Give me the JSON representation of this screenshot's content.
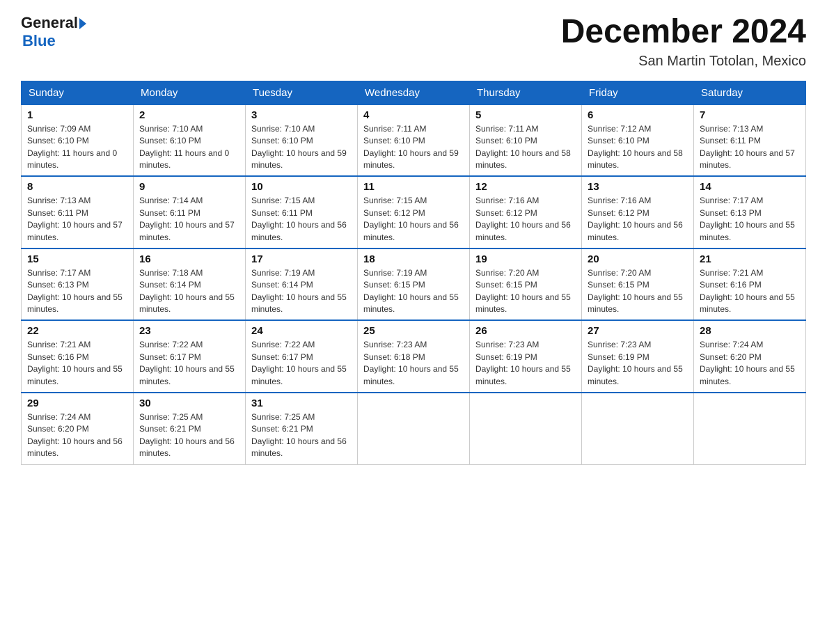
{
  "logo": {
    "general_text": "General",
    "blue_text": "Blue"
  },
  "title": "December 2024",
  "location": "San Martin Totolan, Mexico",
  "days_of_week": [
    "Sunday",
    "Monday",
    "Tuesday",
    "Wednesday",
    "Thursday",
    "Friday",
    "Saturday"
  ],
  "weeks": [
    [
      {
        "day": "1",
        "sunrise": "7:09 AM",
        "sunset": "6:10 PM",
        "daylight": "11 hours and 0 minutes."
      },
      {
        "day": "2",
        "sunrise": "7:10 AM",
        "sunset": "6:10 PM",
        "daylight": "11 hours and 0 minutes."
      },
      {
        "day": "3",
        "sunrise": "7:10 AM",
        "sunset": "6:10 PM",
        "daylight": "10 hours and 59 minutes."
      },
      {
        "day": "4",
        "sunrise": "7:11 AM",
        "sunset": "6:10 PM",
        "daylight": "10 hours and 59 minutes."
      },
      {
        "day": "5",
        "sunrise": "7:11 AM",
        "sunset": "6:10 PM",
        "daylight": "10 hours and 58 minutes."
      },
      {
        "day": "6",
        "sunrise": "7:12 AM",
        "sunset": "6:10 PM",
        "daylight": "10 hours and 58 minutes."
      },
      {
        "day": "7",
        "sunrise": "7:13 AM",
        "sunset": "6:11 PM",
        "daylight": "10 hours and 57 minutes."
      }
    ],
    [
      {
        "day": "8",
        "sunrise": "7:13 AM",
        "sunset": "6:11 PM",
        "daylight": "10 hours and 57 minutes."
      },
      {
        "day": "9",
        "sunrise": "7:14 AM",
        "sunset": "6:11 PM",
        "daylight": "10 hours and 57 minutes."
      },
      {
        "day": "10",
        "sunrise": "7:15 AM",
        "sunset": "6:11 PM",
        "daylight": "10 hours and 56 minutes."
      },
      {
        "day": "11",
        "sunrise": "7:15 AM",
        "sunset": "6:12 PM",
        "daylight": "10 hours and 56 minutes."
      },
      {
        "day": "12",
        "sunrise": "7:16 AM",
        "sunset": "6:12 PM",
        "daylight": "10 hours and 56 minutes."
      },
      {
        "day": "13",
        "sunrise": "7:16 AM",
        "sunset": "6:12 PM",
        "daylight": "10 hours and 56 minutes."
      },
      {
        "day": "14",
        "sunrise": "7:17 AM",
        "sunset": "6:13 PM",
        "daylight": "10 hours and 55 minutes."
      }
    ],
    [
      {
        "day": "15",
        "sunrise": "7:17 AM",
        "sunset": "6:13 PM",
        "daylight": "10 hours and 55 minutes."
      },
      {
        "day": "16",
        "sunrise": "7:18 AM",
        "sunset": "6:14 PM",
        "daylight": "10 hours and 55 minutes."
      },
      {
        "day": "17",
        "sunrise": "7:19 AM",
        "sunset": "6:14 PM",
        "daylight": "10 hours and 55 minutes."
      },
      {
        "day": "18",
        "sunrise": "7:19 AM",
        "sunset": "6:15 PM",
        "daylight": "10 hours and 55 minutes."
      },
      {
        "day": "19",
        "sunrise": "7:20 AM",
        "sunset": "6:15 PM",
        "daylight": "10 hours and 55 minutes."
      },
      {
        "day": "20",
        "sunrise": "7:20 AM",
        "sunset": "6:15 PM",
        "daylight": "10 hours and 55 minutes."
      },
      {
        "day": "21",
        "sunrise": "7:21 AM",
        "sunset": "6:16 PM",
        "daylight": "10 hours and 55 minutes."
      }
    ],
    [
      {
        "day": "22",
        "sunrise": "7:21 AM",
        "sunset": "6:16 PM",
        "daylight": "10 hours and 55 minutes."
      },
      {
        "day": "23",
        "sunrise": "7:22 AM",
        "sunset": "6:17 PM",
        "daylight": "10 hours and 55 minutes."
      },
      {
        "day": "24",
        "sunrise": "7:22 AM",
        "sunset": "6:17 PM",
        "daylight": "10 hours and 55 minutes."
      },
      {
        "day": "25",
        "sunrise": "7:23 AM",
        "sunset": "6:18 PM",
        "daylight": "10 hours and 55 minutes."
      },
      {
        "day": "26",
        "sunrise": "7:23 AM",
        "sunset": "6:19 PM",
        "daylight": "10 hours and 55 minutes."
      },
      {
        "day": "27",
        "sunrise": "7:23 AM",
        "sunset": "6:19 PM",
        "daylight": "10 hours and 55 minutes."
      },
      {
        "day": "28",
        "sunrise": "7:24 AM",
        "sunset": "6:20 PM",
        "daylight": "10 hours and 55 minutes."
      }
    ],
    [
      {
        "day": "29",
        "sunrise": "7:24 AM",
        "sunset": "6:20 PM",
        "daylight": "10 hours and 56 minutes."
      },
      {
        "day": "30",
        "sunrise": "7:25 AM",
        "sunset": "6:21 PM",
        "daylight": "10 hours and 56 minutes."
      },
      {
        "day": "31",
        "sunrise": "7:25 AM",
        "sunset": "6:21 PM",
        "daylight": "10 hours and 56 minutes."
      },
      null,
      null,
      null,
      null
    ]
  ]
}
